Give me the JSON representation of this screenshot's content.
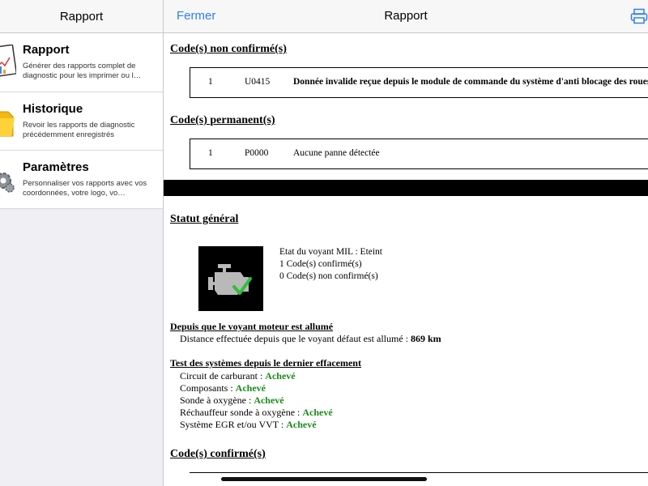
{
  "sidebar": {
    "title": "Rapport",
    "items": [
      {
        "title": "Rapport",
        "desc": "Générer des rapports complet de diagnostic pour les imprimer ou l…",
        "icon": "report-icon"
      },
      {
        "title": "Historique",
        "desc": "Revoir les rapports de diagnostic précédemment enregistrés",
        "icon": "folder-icon"
      },
      {
        "title": "Paramètres",
        "desc": "Personnaliser vos rapports avec vos coordonnées, votre logo, vo…",
        "icon": "gear-icon"
      }
    ]
  },
  "nav": {
    "close_label": "Fermer",
    "title": "Rapport",
    "print_icon": "printer-icon",
    "accent": "#2f7ef5"
  },
  "report": {
    "unconfirmed_heading": "Code(s) non confirmé(s)",
    "unconfirmed_codes": [
      {
        "index": "1",
        "code": "U0415",
        "desc": "Donnée invalide reçue depuis le module de commande du système d'anti blocage des roues"
      }
    ],
    "permanent_heading": "Code(s) permanent(s)",
    "permanent_codes": [
      {
        "index": "1",
        "code": "P0000",
        "desc": "Aucune panne détectée"
      }
    ],
    "general_heading": "Statut général",
    "mil_status": "Etat du voyant MIL : Eteint",
    "confirmed_count": "1 Code(s) confirmé(s)",
    "unconfirmed_count": "0 Code(s) non confirmé(s)",
    "since_mil_heading": "Depuis que le voyant moteur est allumé",
    "distance_label": "Distance effectuée depuis que le voyant défaut est allumé : ",
    "distance_value": "869 km",
    "tests_heading": "Test des systèmes depuis le dernier effacement",
    "tests": [
      {
        "label": "Circuit de carburant : ",
        "status": "Achevé"
      },
      {
        "label": "Composants : ",
        "status": "Achevé"
      },
      {
        "label": "Sonde à oxygène : ",
        "status": "Achevé"
      },
      {
        "label": "Réchauffeur sonde à oxygène : ",
        "status": "Achevé"
      },
      {
        "label": "Système EGR et/ou VVT : ",
        "status": "Achevé"
      }
    ],
    "confirmed_heading": "Code(s) confirmé(s)",
    "ok_color": "#1a8a1a"
  }
}
